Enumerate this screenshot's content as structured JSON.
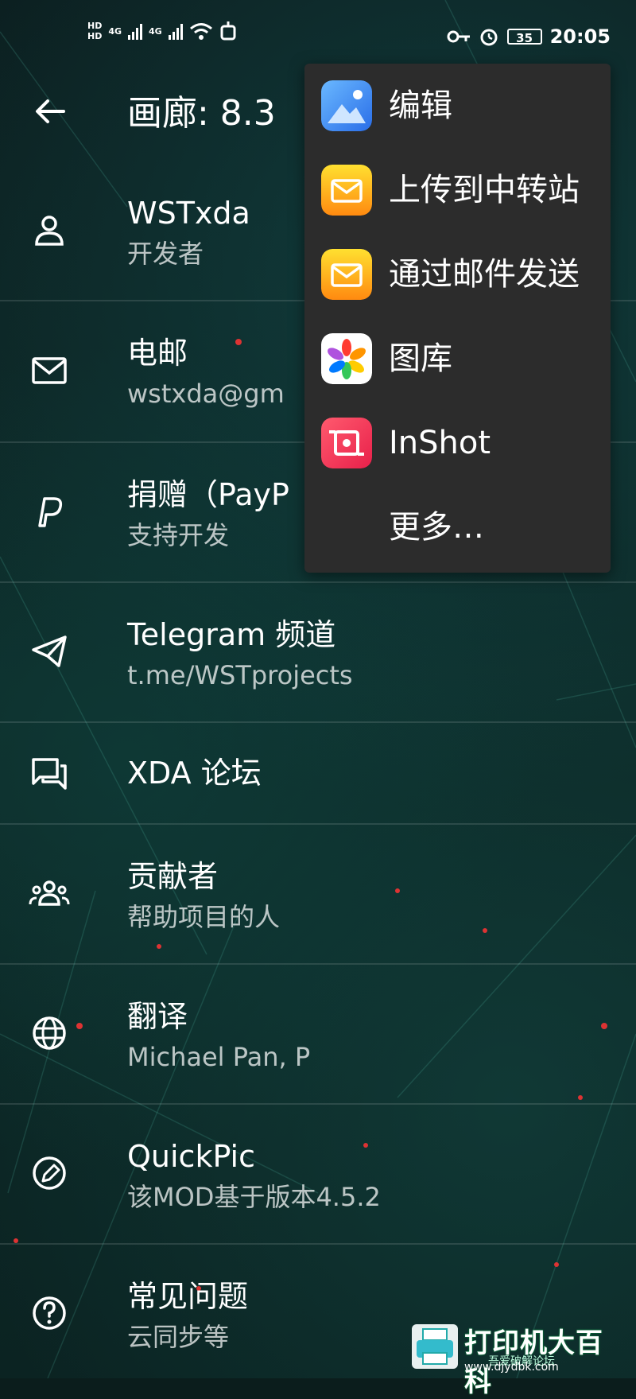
{
  "status_bar": {
    "hd1": "HD",
    "hd2": "HD",
    "sim1_net": "4G",
    "sim2_net": "4G",
    "battery": "35",
    "time": "20:05"
  },
  "topbar": {
    "back_icon": "arrow-left-icon",
    "title": "画廊: 8.3"
  },
  "list": [
    {
      "icon": "person-icon",
      "title": "WSTxda",
      "subtitle": "开发者"
    },
    {
      "icon": "mail-icon",
      "title": "电邮",
      "subtitle": "wstxda@gm"
    },
    {
      "icon": "paypal-icon",
      "title": "捐赠（PayP",
      "subtitle": "支持开发"
    },
    {
      "icon": "telegram-icon",
      "title": "Telegram 频道",
      "subtitle": "t.me/WSTprojects"
    },
    {
      "icon": "forum-icon",
      "title": "XDA 论坛",
      "subtitle": ""
    },
    {
      "icon": "group-icon",
      "title": "贡献者",
      "subtitle": "帮助项目的人"
    },
    {
      "icon": "globe-icon",
      "title": "翻译",
      "subtitle": "Michael Pan, P"
    },
    {
      "icon": "edit-icon",
      "title": "QuickPic",
      "subtitle": "该MOD基于版本4.5.2"
    },
    {
      "icon": "help-icon",
      "title": "常见问题",
      "subtitle": "云同步等"
    }
  ],
  "share_menu": [
    {
      "icon": "gallery-edit-icon",
      "label": "编辑",
      "color": "#3a8ef0"
    },
    {
      "icon": "mail-app-icon",
      "label": "上传到中转站",
      "color": "#f7a81b"
    },
    {
      "icon": "mail-app-icon",
      "label": "通过邮件发送",
      "color": "#f7a81b"
    },
    {
      "icon": "photos-flower-icon",
      "label": "图库",
      "color": "#ffffff"
    },
    {
      "icon": "inshot-icon",
      "label": "InShot",
      "color": "#f03a5a"
    },
    {
      "icon": "",
      "label": "更多…",
      "color": ""
    }
  ],
  "watermark": {
    "text": "打印机大百科",
    "sub": "吾爱破解论坛",
    "url": "www.djydbk.com"
  }
}
